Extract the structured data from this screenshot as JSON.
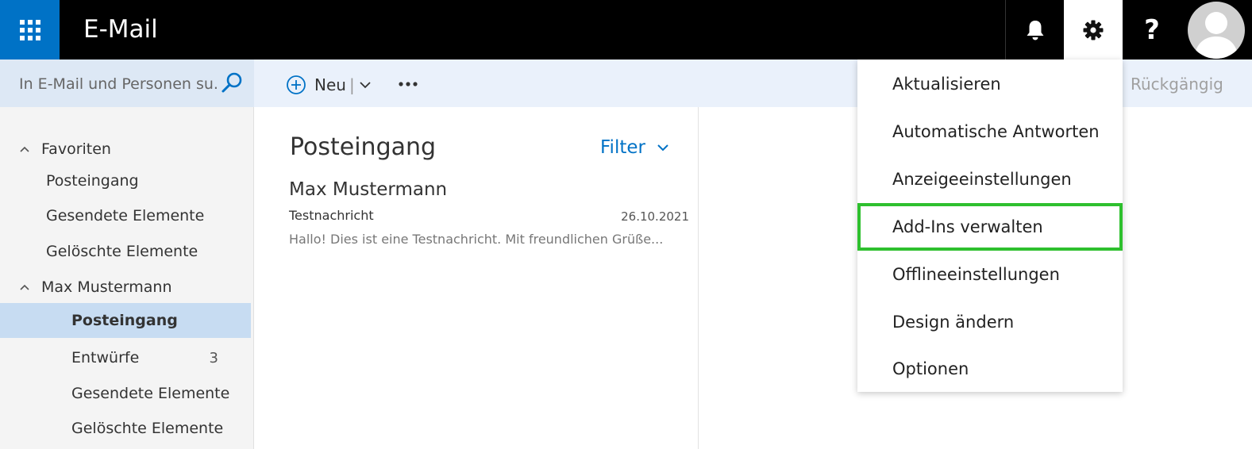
{
  "header": {
    "app_title": "E-Mail",
    "icons": [
      "app-launcher-icon",
      "bell-icon",
      "gear-icon",
      "help-icon",
      "avatar-icon"
    ],
    "help_label": "?"
  },
  "search": {
    "placeholder": "In E-Mail und Personen su..."
  },
  "toolbar": {
    "new_label": "Neu",
    "new_separator": "|",
    "undo_label": "Rückgängig"
  },
  "sidebar": {
    "groups": [
      {
        "label": "Favoriten",
        "items": [
          {
            "label": "Posteingang"
          },
          {
            "label": "Gesendete Elemente"
          },
          {
            "label": "Gelöschte Elemente"
          }
        ]
      },
      {
        "label": "Max Mustermann",
        "items": [
          {
            "label": "Posteingang",
            "selected": true
          },
          {
            "label": "Entwürfe",
            "count": "3"
          },
          {
            "label": "Gesendete Elemente"
          },
          {
            "label": "Gelöschte Elemente"
          }
        ]
      }
    ]
  },
  "message_list": {
    "title": "Posteingang",
    "filter_label": "Filter",
    "messages": [
      {
        "from": "Max Mustermann",
        "subject": "Testnachricht",
        "date": "26.10.2021",
        "preview": "Hallo! Dies ist eine Testnachricht. Mit freundlichen Grüße..."
      }
    ]
  },
  "settings_menu": {
    "items": [
      {
        "label": "Aktualisieren"
      },
      {
        "label": "Automatische Antworten"
      },
      {
        "label": "Anzeigeeinstellungen"
      },
      {
        "label": "Add-Ins verwalten",
        "highlighted": true
      },
      {
        "label": "Offlineeinstellungen"
      },
      {
        "label": "Design ändern"
      },
      {
        "label": "Optionen"
      }
    ]
  },
  "colors": {
    "brand_blue": "#0072c6",
    "topbar": "#000000",
    "selected_nav": "#c7dcf2",
    "highlight_border": "#2ec02e"
  }
}
